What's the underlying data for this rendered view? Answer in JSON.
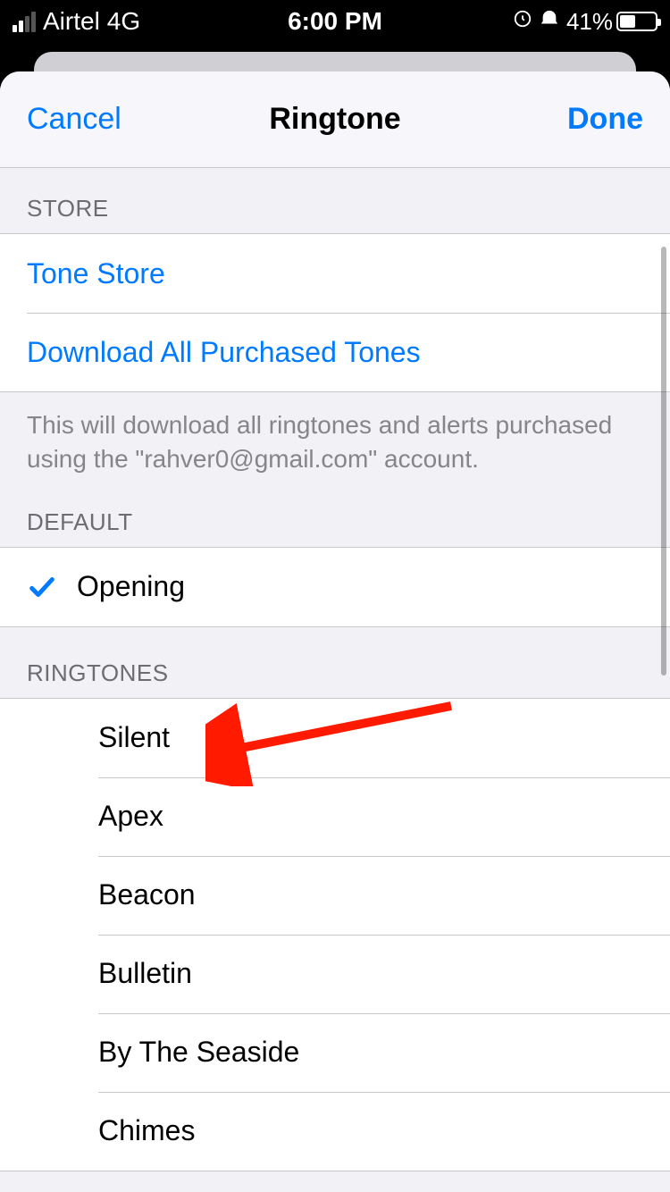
{
  "status": {
    "carrier": "Airtel",
    "network": "4G",
    "time": "6:00 PM",
    "battery_pct": "41%"
  },
  "nav": {
    "cancel": "Cancel",
    "title": "Ringtone",
    "done": "Done"
  },
  "sections": {
    "store_header": "STORE",
    "tone_store": "Tone Store",
    "download_all": "Download All Purchased Tones",
    "download_footer": "This will download all ringtones and alerts purchased using the \"rahver0@gmail.com\" account.",
    "default_header": "DEFAULT",
    "default_item": "Opening",
    "ringtones_header": "RINGTONES",
    "ringtones": [
      "Silent",
      "Apex",
      "Beacon",
      "Bulletin",
      "By The Seaside",
      "Chimes"
    ]
  }
}
